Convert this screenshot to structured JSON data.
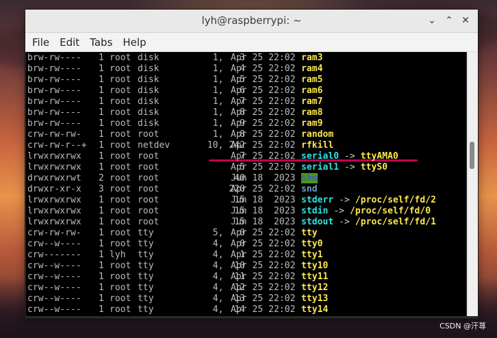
{
  "window": {
    "title": "lyh@raspberrypi: ~",
    "minimize_glyph": "⌄",
    "maximize_glyph": "⌃",
    "close_glyph": "✕"
  },
  "menu": [
    "File",
    "Edit",
    "Tabs",
    "Help"
  ],
  "rows": [
    {
      "perms": "brw-rw----",
      "links": "1",
      "user": "root",
      "group": "disk",
      "size": "1,   3",
      "date": "Apr 25 22:02",
      "name": "ram3",
      "style": "yellow"
    },
    {
      "perms": "brw-rw----",
      "links": "1",
      "user": "root",
      "group": "disk",
      "size": "1,   4",
      "date": "Apr 25 22:02",
      "name": "ram4",
      "style": "yellow"
    },
    {
      "perms": "brw-rw----",
      "links": "1",
      "user": "root",
      "group": "disk",
      "size": "1,   5",
      "date": "Apr 25 22:02",
      "name": "ram5",
      "style": "yellow"
    },
    {
      "perms": "brw-rw----",
      "links": "1",
      "user": "root",
      "group": "disk",
      "size": "1,   6",
      "date": "Apr 25 22:02",
      "name": "ram6",
      "style": "yellow"
    },
    {
      "perms": "brw-rw----",
      "links": "1",
      "user": "root",
      "group": "disk",
      "size": "1,   7",
      "date": "Apr 25 22:02",
      "name": "ram7",
      "style": "yellow"
    },
    {
      "perms": "brw-rw----",
      "links": "1",
      "user": "root",
      "group": "disk",
      "size": "1,   8",
      "date": "Apr 25 22:02",
      "name": "ram8",
      "style": "yellow"
    },
    {
      "perms": "brw-rw----",
      "links": "1",
      "user": "root",
      "group": "disk",
      "size": "1,   9",
      "date": "Apr 25 22:02",
      "name": "ram9",
      "style": "yellow"
    },
    {
      "perms": "crw-rw-rw-",
      "links": "1",
      "user": "root",
      "group": "root",
      "size": "1,   8",
      "date": "Apr 25 22:02",
      "name": "random",
      "style": "yellow"
    },
    {
      "perms": "crw-rw-r--+",
      "links": "1",
      "user": "root",
      "group": "netdev",
      "size": "10, 242",
      "date": "Apr 25 22:02",
      "name": "rfkill",
      "style": "yellow"
    },
    {
      "perms": "lrwxrwxrwx",
      "links": "1",
      "user": "root",
      "group": "root",
      "size": "7",
      "date": "Apr 25 22:02",
      "name": "serial0",
      "target": "ttyAMA0",
      "style": "cyan",
      "target_style": "yellow"
    },
    {
      "perms": "lrwxrwxrwx",
      "links": "1",
      "user": "root",
      "group": "root",
      "size": "5",
      "date": "Apr 25 22:02",
      "name": "serial1",
      "target": "ttyS0",
      "style": "cyan",
      "target_style": "yellow"
    },
    {
      "perms": "drwxrwxrwt",
      "links": "2",
      "user": "root",
      "group": "root",
      "size": "40",
      "date": "Jun 18  2023",
      "name": "shm",
      "style": "shm"
    },
    {
      "perms": "drwxr-xr-x",
      "links": "3",
      "user": "root",
      "group": "root",
      "size": "220",
      "date": "Apr 25 22:02",
      "name": "snd",
      "style": "blue"
    },
    {
      "perms": "lrwxrwxrwx",
      "links": "1",
      "user": "root",
      "group": "root",
      "size": "15",
      "date": "Jun 18  2023",
      "name": "stderr",
      "target": "/proc/self/fd/2",
      "style": "cyan",
      "target_style": "yellow"
    },
    {
      "perms": "lrwxrwxrwx",
      "links": "1",
      "user": "root",
      "group": "root",
      "size": "15",
      "date": "Jun 18  2023",
      "name": "stdin",
      "target": "/proc/self/fd/0",
      "style": "cyan",
      "target_style": "yellow"
    },
    {
      "perms": "lrwxrwxrwx",
      "links": "1",
      "user": "root",
      "group": "root",
      "size": "15",
      "date": "Jun 18  2023",
      "name": "stdout",
      "target": "/proc/self/fd/1",
      "style": "cyan",
      "target_style": "yellow"
    },
    {
      "perms": "crw-rw-rw-",
      "links": "1",
      "user": "root",
      "group": "tty",
      "size": "5,   0",
      "date": "Apr 25 22:02",
      "name": "tty",
      "style": "yellow"
    },
    {
      "perms": "crw--w----",
      "links": "1",
      "user": "root",
      "group": "tty",
      "size": "4,   0",
      "date": "Apr 25 22:02",
      "name": "tty0",
      "style": "yellow"
    },
    {
      "perms": "crw-------",
      "links": "1",
      "user": "lyh",
      "group": "tty",
      "size": "4,   1",
      "date": "Apr 25 22:02",
      "name": "tty1",
      "style": "yellow"
    },
    {
      "perms": "crw--w----",
      "links": "1",
      "user": "root",
      "group": "tty",
      "size": "4,  10",
      "date": "Apr 25 22:02",
      "name": "tty10",
      "style": "yellow"
    },
    {
      "perms": "crw--w----",
      "links": "1",
      "user": "root",
      "group": "tty",
      "size": "4,  11",
      "date": "Apr 25 22:02",
      "name": "tty11",
      "style": "yellow"
    },
    {
      "perms": "crw--w----",
      "links": "1",
      "user": "root",
      "group": "tty",
      "size": "4,  12",
      "date": "Apr 25 22:02",
      "name": "tty12",
      "style": "yellow"
    },
    {
      "perms": "crw--w----",
      "links": "1",
      "user": "root",
      "group": "tty",
      "size": "4,  13",
      "date": "Apr 25 22:02",
      "name": "tty13",
      "style": "yellow"
    },
    {
      "perms": "crw--w----",
      "links": "1",
      "user": "root",
      "group": "tty",
      "size": "4,  14",
      "date": "Apr 25 22:02",
      "name": "tty14",
      "style": "yellow"
    }
  ],
  "arrow": "->",
  "highlight_color": "#c4004f",
  "watermark": "CSDN @汗荨"
}
